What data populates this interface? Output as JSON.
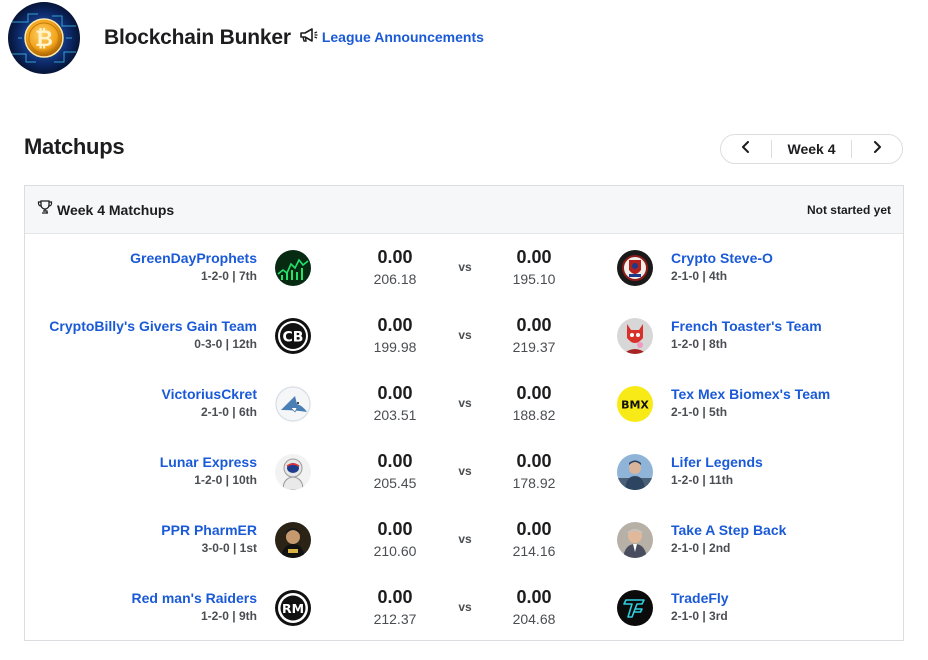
{
  "league": {
    "name": "Blockchain Bunker",
    "announcements_label": "League Announcements"
  },
  "section": {
    "title": "Matchups"
  },
  "week_nav": {
    "label": "Week 4"
  },
  "card": {
    "title": "Week 4 Matchups",
    "status": "Not started yet"
  },
  "vs_label": "vs",
  "colors": {
    "link": "#1a5ad7",
    "text": "#1d1d1f",
    "muted": "#4a4d52",
    "border": "#dcdde0",
    "header_bg": "#f5f7f9"
  },
  "matchups": [
    {
      "left": {
        "name": "GreenDayProphets",
        "record": "1-2-0 | 7th",
        "score": "0.00",
        "projected": "206.18",
        "avatar": "green-chart-avatar"
      },
      "right": {
        "name": "Crypto Steve-O",
        "record": "2-1-0 | 4th",
        "score": "0.00",
        "projected": "195.10",
        "avatar": "badge-avatar"
      }
    },
    {
      "left": {
        "name": "CryptoBilly's Givers Gain Team",
        "record": "0-3-0 | 12th",
        "score": "0.00",
        "projected": "199.98",
        "avatar": "cb-logo-avatar",
        "initials": "CB"
      },
      "right": {
        "name": "French Toaster's Team",
        "record": "1-2-0 | 8th",
        "score": "0.00",
        "projected": "219.37",
        "avatar": "red-character-avatar"
      }
    },
    {
      "left": {
        "name": "VictoriusCkret",
        "record": "2-1-0 | 6th",
        "score": "0.00",
        "projected": "203.51",
        "avatar": "shark-avatar"
      },
      "right": {
        "name": "Tex Mex Biomex's Team",
        "record": "2-1-0 | 5th",
        "score": "0.00",
        "projected": "188.82",
        "avatar": "bmx-logo-avatar",
        "initials": "BMX"
      }
    },
    {
      "left": {
        "name": "Lunar Express",
        "record": "1-2-0 | 10th",
        "score": "0.00",
        "projected": "205.45",
        "avatar": "astronaut-avatar"
      },
      "right": {
        "name": "Lifer Legends",
        "record": "1-2-0 | 11th",
        "score": "0.00",
        "projected": "178.92",
        "avatar": "photo-avatar"
      }
    },
    {
      "left": {
        "name": "PPR PharmER",
        "record": "3-0-0 | 1st",
        "score": "0.00",
        "projected": "210.60",
        "avatar": "dark-photo-avatar"
      },
      "right": {
        "name": "Take A Step Back",
        "record": "2-1-0 | 2nd",
        "score": "0.00",
        "projected": "214.16",
        "avatar": "person-photo-avatar"
      }
    },
    {
      "left": {
        "name": "Red man's Raiders",
        "record": "1-2-0 | 9th",
        "score": "0.00",
        "projected": "212.37",
        "avatar": "rm-logo-avatar",
        "initials": "RM"
      },
      "right": {
        "name": "TradeFly",
        "record": "2-1-0 | 3rd",
        "score": "0.00",
        "projected": "204.68",
        "avatar": "tf-logo-avatar"
      }
    }
  ]
}
